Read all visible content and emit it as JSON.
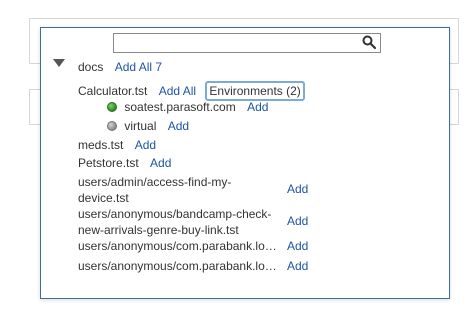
{
  "search": {
    "value": "",
    "placeholder": ""
  },
  "tree": {
    "root": {
      "label": "docs",
      "action": "Add All 7"
    },
    "calculator": {
      "label": "Calculator.tst",
      "action": "Add All",
      "env_button": "Environments (2)",
      "envs": [
        {
          "label": "soatest.parasoft.com",
          "action": "Add",
          "status_color": "#2e8b22"
        },
        {
          "label": "virtual",
          "action": "Add",
          "status_color": "#8a8a8a"
        }
      ]
    },
    "meds": {
      "label": "meds.tst",
      "action": "Add"
    },
    "petstore": {
      "label": "Petstore.tst",
      "action": "Add"
    },
    "files": [
      {
        "label": "users/admin/access-find-my-device.tst",
        "action": "Add"
      },
      {
        "label": "users/anonymous/bandcamp-check-new-arrivals-genre-buy-link.tst",
        "action": "Add"
      },
      {
        "label": "users/anonymous/com.parabank.lo…",
        "action": "Add"
      },
      {
        "label": "users/anonymous/com.parabank.lo…",
        "action": "Add"
      }
    ]
  },
  "colors": {
    "accent": "#3d6e97",
    "link": "#1d55a5",
    "env_border": "#7fa9d6"
  }
}
